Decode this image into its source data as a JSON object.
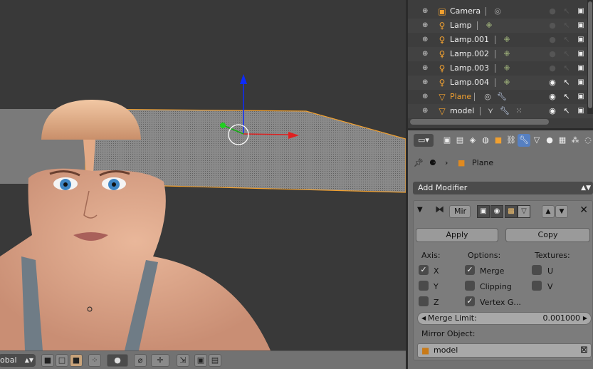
{
  "viewport": {
    "mode_label": "obal",
    "toolbar_icons": [
      "solid-cube-icon",
      "wire-cube-icon",
      "texture-cube-icon",
      "pivot-icon",
      "shading-dot-icon",
      "snap-icon",
      "manipulator-icon",
      "render-icon",
      "camera-render-icon",
      "clapper-icon"
    ]
  },
  "outliner": {
    "rows": [
      {
        "name": "Camera",
        "icon": "camera-icon",
        "selected": false,
        "visible": false
      },
      {
        "name": "Lamp",
        "icon": "lamp-icon",
        "selected": false,
        "visible": false
      },
      {
        "name": "Lamp.001",
        "icon": "lamp-icon",
        "selected": false,
        "visible": false
      },
      {
        "name": "Lamp.002",
        "icon": "lamp-icon",
        "selected": false,
        "visible": false
      },
      {
        "name": "Lamp.003",
        "icon": "lamp-icon",
        "selected": false,
        "visible": false
      },
      {
        "name": "Lamp.004",
        "icon": "lamp-icon",
        "selected": false,
        "visible": true
      },
      {
        "name": "Plane",
        "icon": "mesh-icon",
        "selected": true,
        "visible": true
      },
      {
        "name": "model",
        "icon": "mesh-icon",
        "selected": false,
        "visible": true
      }
    ]
  },
  "properties": {
    "context_object": "Plane",
    "add_modifier_label": "Add Modifier",
    "modifier": {
      "name": "Mir",
      "apply_label": "Apply",
      "copy_label": "Copy",
      "axis_label": "Axis:",
      "options_label": "Options:",
      "textures_label": "Textures:",
      "axis": [
        {
          "label": "X",
          "checked": true
        },
        {
          "label": "Y",
          "checked": false
        },
        {
          "label": "Z",
          "checked": false
        }
      ],
      "options": [
        {
          "label": "Merge",
          "checked": true
        },
        {
          "label": "Clipping",
          "checked": false
        },
        {
          "label": "Vertex G...",
          "checked": true
        }
      ],
      "textures": [
        {
          "label": "U",
          "checked": false
        },
        {
          "label": "V",
          "checked": false
        }
      ],
      "merge_limit_label": "Merge Limit:",
      "merge_limit_value": "0.001000",
      "mirror_object_label": "Mirror Object:",
      "mirror_object_value": "model"
    }
  },
  "colors": {
    "selection_orange": "#f0a030",
    "active_tab_blue": "#5680c2",
    "viewport_bg": "#393939"
  }
}
